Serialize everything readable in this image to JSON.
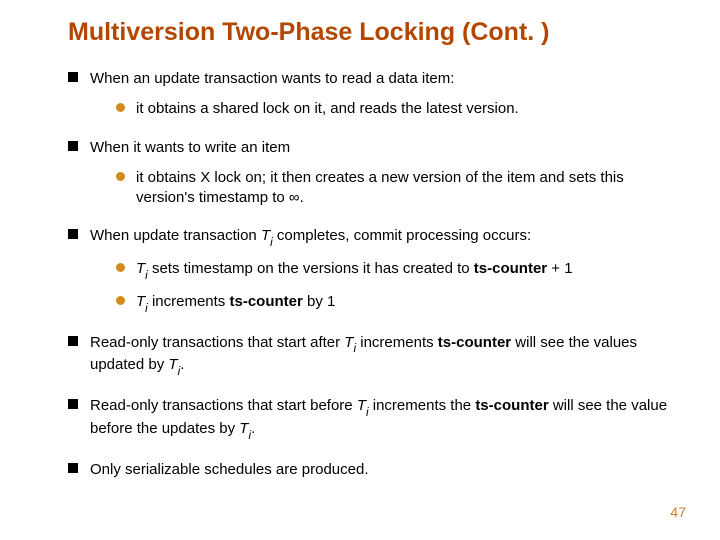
{
  "title": "Multiversion Two-Phase Locking (Cont. )",
  "bullets": {
    "b1": "When an update transaction wants to read a data item:",
    "b1_1": "it obtains a shared lock on it, and reads the latest version.",
    "b2": "When it wants to write an item",
    "b2_1": "it obtains X lock on; it then creates a new version of the item and sets this version's timestamp to ∞.",
    "b3_pre": "When update transaction ",
    "b3_T": "T",
    "b3_i": "i",
    "b3_post": " completes, commit processing occurs:",
    "b3_1_T": "T",
    "b3_1_i": "i",
    "b3_1_mid": " sets timestamp on the versions it has created to  ",
    "b3_1_bold": "ts-counter",
    "b3_1_tail": " + 1",
    "b3_2_T": "T",
    "b3_2_i": "i",
    "b3_2_mid": " increments  ",
    "b3_2_bold": "ts-counter",
    "b3_2_tail": " by 1",
    "b4_pre": "Read-only transactions that start after ",
    "b4_T": "T",
    "b4_i": "i",
    "b4_mid": " increments ",
    "b4_bold": "ts-counter",
    "b4_mid2": " will see the values updated by ",
    "b4_T2": "T",
    "b4_i2": "i",
    "b4_tail": ".",
    "b5_pre": "Read-only transactions that start before ",
    "b5_T": "T",
    "b5_i": "i",
    "b5_mid": " increments the ",
    "b5_bold": "ts-counter",
    "b5_mid2": " will see the value before the updates by ",
    "b5_T2": "T",
    "b5_i2": "i",
    "b5_tail": ".",
    "b6": "Only serializable schedules are produced."
  },
  "page_number": "47"
}
